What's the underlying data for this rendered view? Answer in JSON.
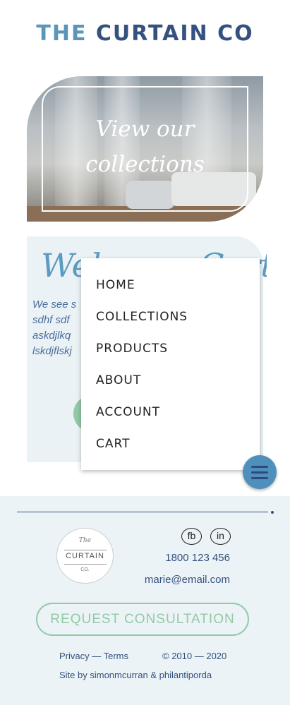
{
  "header": {
    "brand_part1": "THE",
    "brand_part2": "CURTAIN CO"
  },
  "hero": {
    "title_line1": "View our",
    "title_line2": "collections"
  },
  "welcome": {
    "title": "Welcome Curtains",
    "text_lines": [
      "We see s",
      "sdhf sdf",
      "askdjlkq",
      "lskdjflskj"
    ]
  },
  "menu": {
    "items": [
      "HOME",
      "COLLECTIONS",
      "PRODUCTS",
      "ABOUT",
      "ACCOUNT",
      "CART"
    ]
  },
  "footer": {
    "logo": {
      "line1": "The",
      "line2": "CURTAIN",
      "line3": "CO."
    },
    "social": {
      "facebook": "fb",
      "linkedin": "in"
    },
    "phone": "1800 123 456",
    "email": "marie@email.com",
    "cta": "REQUEST CONSULTATION",
    "privacy_terms": "Privacy — Terms",
    "copyright": "© 2010 — 2020",
    "credits": "Site by simonmcurran & philantiporda"
  },
  "colors": {
    "primary": "#34517f",
    "accent": "#5b95b8",
    "green": "#93c9a5",
    "footer_bg": "#ecf3f6"
  },
  "icons": {
    "menu_button": "hamburger-icon"
  }
}
